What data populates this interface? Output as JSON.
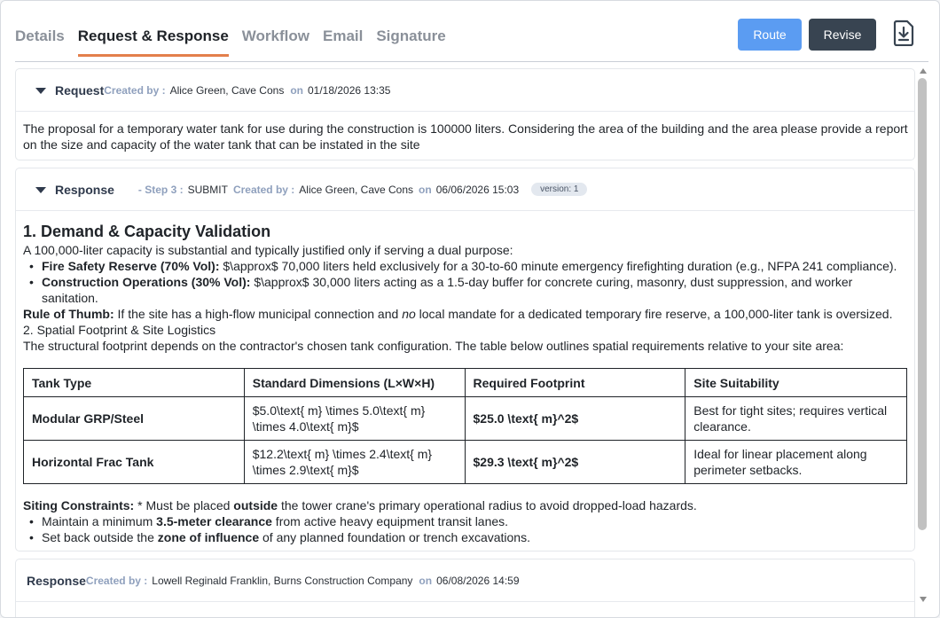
{
  "tabs": [
    {
      "label": "Details",
      "active": false
    },
    {
      "label": "Request & Response",
      "active": true
    },
    {
      "label": "Workflow",
      "active": false
    },
    {
      "label": "Email",
      "active": false
    },
    {
      "label": "Signature",
      "active": false
    }
  ],
  "toolbar": {
    "route_label": "Route",
    "revise_label": "Revise",
    "export_icon": "download-file-icon",
    "route_color": "#5b9cf2",
    "revise_color": "#384451"
  },
  "accent_color": "#e37f4c",
  "request": {
    "title": "Request",
    "created_by_label": "Created by :",
    "author": "Alice Green, Cave Cons",
    "on_label": "on",
    "date": "01/18/2026 13:35",
    "body": "The proposal for a temporary water tank for use during the construction is 100000 liters. Considering the area of the building and the area please provide a report on the size and capacity of the water tank that can be instated in the site"
  },
  "response1": {
    "title": "Response",
    "step": "- Step 3 :",
    "step_value": "SUBMIT",
    "created_by_label": "Created by :",
    "author": "Alice Green, Cave Cons",
    "on_label": "on",
    "date": "06/06/2026 15:03",
    "version": "version: 1",
    "heading": "1. Demand & Capacity Validation",
    "intro": "A 100,000-liter capacity is substantial and typically justified only if serving a dual purpose:",
    "bullets": [
      {
        "bold": "Fire Safety Reserve (70% Vol):",
        "text": " $\\approx$ 70,000 liters held exclusively for a 30-to-60 minute emergency firefighting duration (e.g., NFPA 241 compliance)."
      },
      {
        "bold": "Construction Operations (30% Vol):",
        "text": " $\\approx$ 30,000 liters acting as a 1.5-day buffer for concrete curing, masonry, dust suppression, and worker sanitation."
      }
    ],
    "rule_bold": "Rule of Thumb:",
    "rule_text_a": " If the site has a high-flow municipal connection and ",
    "rule_italic": "no",
    "rule_text_b": " local mandate for a dedicated temporary fire reserve, a 100,000-liter tank is oversized.",
    "section2": "2. Spatial Footprint & Site Logistics",
    "section2_text": "The structural footprint depends on the contractor's chosen tank configuration. The table below outlines spatial requirements relative to your site area:",
    "table": {
      "headers": [
        "Tank Type",
        "Standard Dimensions (L×W×H)",
        "Required Footprint",
        "Site Suitability"
      ],
      "rows": [
        [
          "Modular GRP/Steel",
          "$5.0\\text{ m} \\times 5.0\\text{ m} \\times 4.0\\text{ m}$",
          "$25.0 \\text{ m}^2$",
          "Best for tight sites; requires vertical clearance."
        ],
        [
          "Horizontal Frac Tank",
          "$12.2\\text{ m} \\times 2.4\\text{ m} \\times 2.9\\text{ m}$",
          "$29.3 \\text{ m}^2$",
          "Ideal for linear placement along perimeter setbacks."
        ]
      ]
    },
    "siting_bold": "Siting Constraints:",
    "siting_text_a": " * Must be placed ",
    "siting_bold2": "outside",
    "siting_text_b": " the tower crane's primary operational radius to avoid dropped-load hazards.",
    "siting_bullets": [
      {
        "a": "Maintain a minimum ",
        "b": "3.5-meter clearance",
        "c": " from active heavy equipment transit lanes."
      },
      {
        "a": "Set back outside the ",
        "b": "zone of influence",
        "c": " of any planned foundation or trench excavations."
      }
    ]
  },
  "response2": {
    "title": "Response",
    "created_by_label": "Created by :",
    "author": "Lowell Reginald Franklin, Burns Construction Company",
    "on_label": "on",
    "date": "06/08/2026 14:59"
  }
}
